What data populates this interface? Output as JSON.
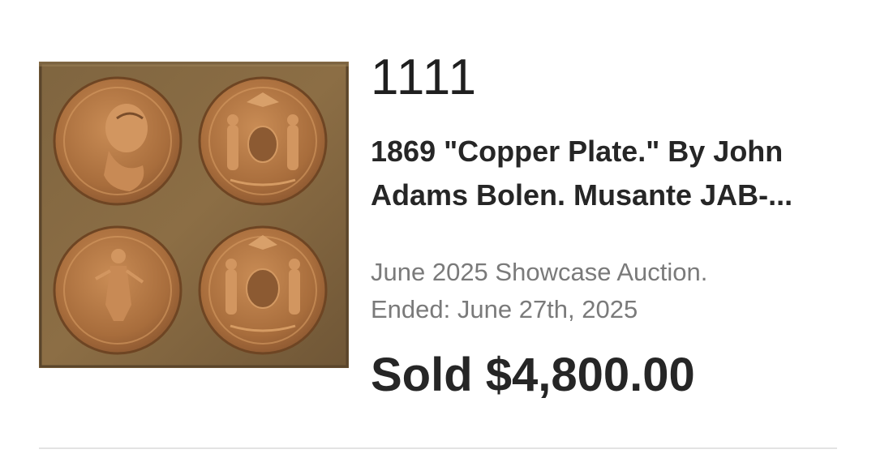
{
  "lot": {
    "number": "1111",
    "title": "1869 \"Copper Plate.\" By John Adams Bolen. Musante JAB-...",
    "auction_name": "June 2025 Showcase Auction.",
    "ended": "Ended: June 27th, 2025",
    "sold_price": "Sold $4,800.00"
  },
  "colors": {
    "text_primary": "#262626",
    "text_secondary": "#7a7a7a",
    "divider": "#e3e3e3",
    "plate_copper": "#8a6a40",
    "medal_copper": "#b57a45"
  },
  "image": {
    "subject": "copper plate with four medal impressions",
    "medal_icons": [
      "portrait-medal-icon",
      "coat-of-arms-medal-icon",
      "standing-figure-medal-icon",
      "state-seal-medal-icon"
    ]
  }
}
